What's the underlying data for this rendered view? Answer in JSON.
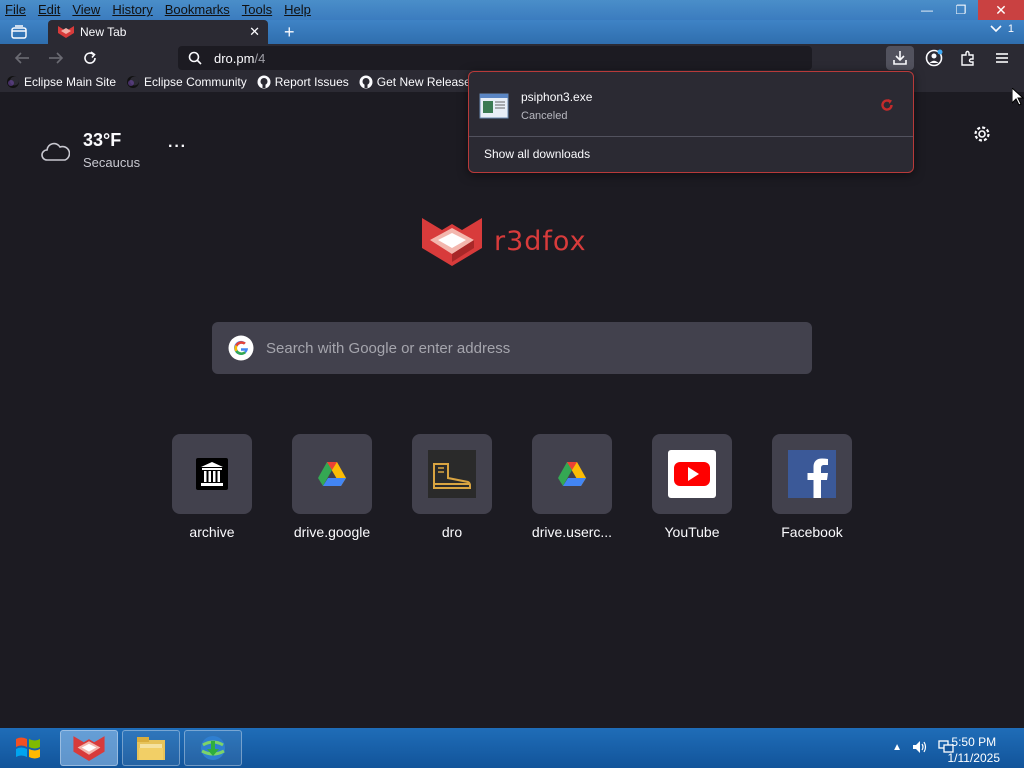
{
  "menu": [
    "File",
    "Edit",
    "View",
    "History",
    "Bookmarks",
    "Tools",
    "Help"
  ],
  "tab": {
    "title": "New Tab"
  },
  "alltabs_count": "1",
  "url": {
    "host": "dro.pm",
    "path": "/4"
  },
  "bookmarks": [
    "Eclipse Main Site",
    "Eclipse Community",
    "Report Issues",
    "Get New Releases"
  ],
  "weather": {
    "temp": "33°F",
    "location": "Secaucus"
  },
  "logo_text": "r3dfox",
  "search": {
    "placeholder": "Search with Google or enter address"
  },
  "tiles": [
    {
      "label": "archive",
      "icon": "archive-icon"
    },
    {
      "label": "drive.google",
      "icon": "google-drive-icon"
    },
    {
      "label": "dro",
      "icon": "dro-icon"
    },
    {
      "label": "drive.userc...",
      "icon": "google-drive-icon"
    },
    {
      "label": "YouTube",
      "icon": "youtube-icon"
    },
    {
      "label": "Facebook",
      "icon": "facebook-icon"
    }
  ],
  "downloads": {
    "file_name": "psiphon3.exe",
    "status": "Canceled",
    "show_all": "Show all downloads"
  },
  "clock": {
    "time": "5:50 PM",
    "date": "1/11/2025"
  },
  "colors": {
    "accent": "#d83b3b",
    "taskbar": "#1f6db8",
    "content_bg": "#1c1b22"
  }
}
